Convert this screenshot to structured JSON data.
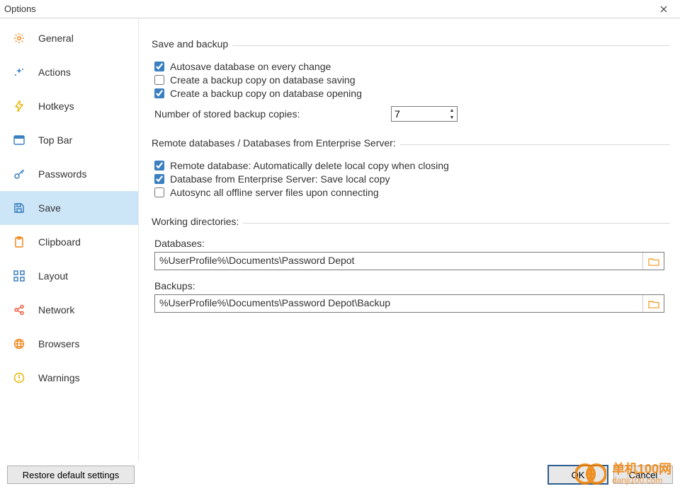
{
  "window": {
    "title": "Options"
  },
  "sidebar": {
    "items": [
      {
        "label": "General"
      },
      {
        "label": "Actions"
      },
      {
        "label": "Hotkeys"
      },
      {
        "label": "Top Bar"
      },
      {
        "label": "Passwords"
      },
      {
        "label": "Save"
      },
      {
        "label": "Clipboard"
      },
      {
        "label": "Layout"
      },
      {
        "label": "Network"
      },
      {
        "label": "Browsers"
      },
      {
        "label": "Warnings"
      }
    ],
    "selected_index": 5
  },
  "groups": {
    "save_backup": {
      "legend": "Save and backup",
      "autosave": {
        "label": "Autosave database on every change",
        "checked": true
      },
      "backup_on_save": {
        "label": "Create a backup copy on database saving",
        "checked": false
      },
      "backup_on_open": {
        "label": "Create a backup copy on database opening",
        "checked": true
      },
      "num_copies_label": "Number of stored backup copies:",
      "num_copies_value": "7"
    },
    "remote": {
      "legend": "Remote databases / Databases from Enterprise Server:",
      "auto_delete": {
        "label": "Remote database: Automatically delete local copy when closing",
        "checked": true
      },
      "enterprise_local": {
        "label": "Database from Enterprise Server: Save local copy",
        "checked": true
      },
      "autosync": {
        "label": "Autosync all offline server files upon connecting",
        "checked": false
      }
    },
    "dirs": {
      "legend": "Working directories:",
      "databases_label": "Databases:",
      "databases_path": "%UserProfile%\\Documents\\Password Depot",
      "backups_label": "Backups:",
      "backups_path": "%UserProfile%\\Documents\\Password Depot\\Backup"
    }
  },
  "footer": {
    "restore": "Restore default settings",
    "ok": "OK",
    "cancel": "Cancel"
  },
  "watermark": {
    "line1": "单机100网",
    "line2": "danji100.com"
  },
  "colors": {
    "accent": "#f08314",
    "selected_bg": "#cde6f7"
  }
}
